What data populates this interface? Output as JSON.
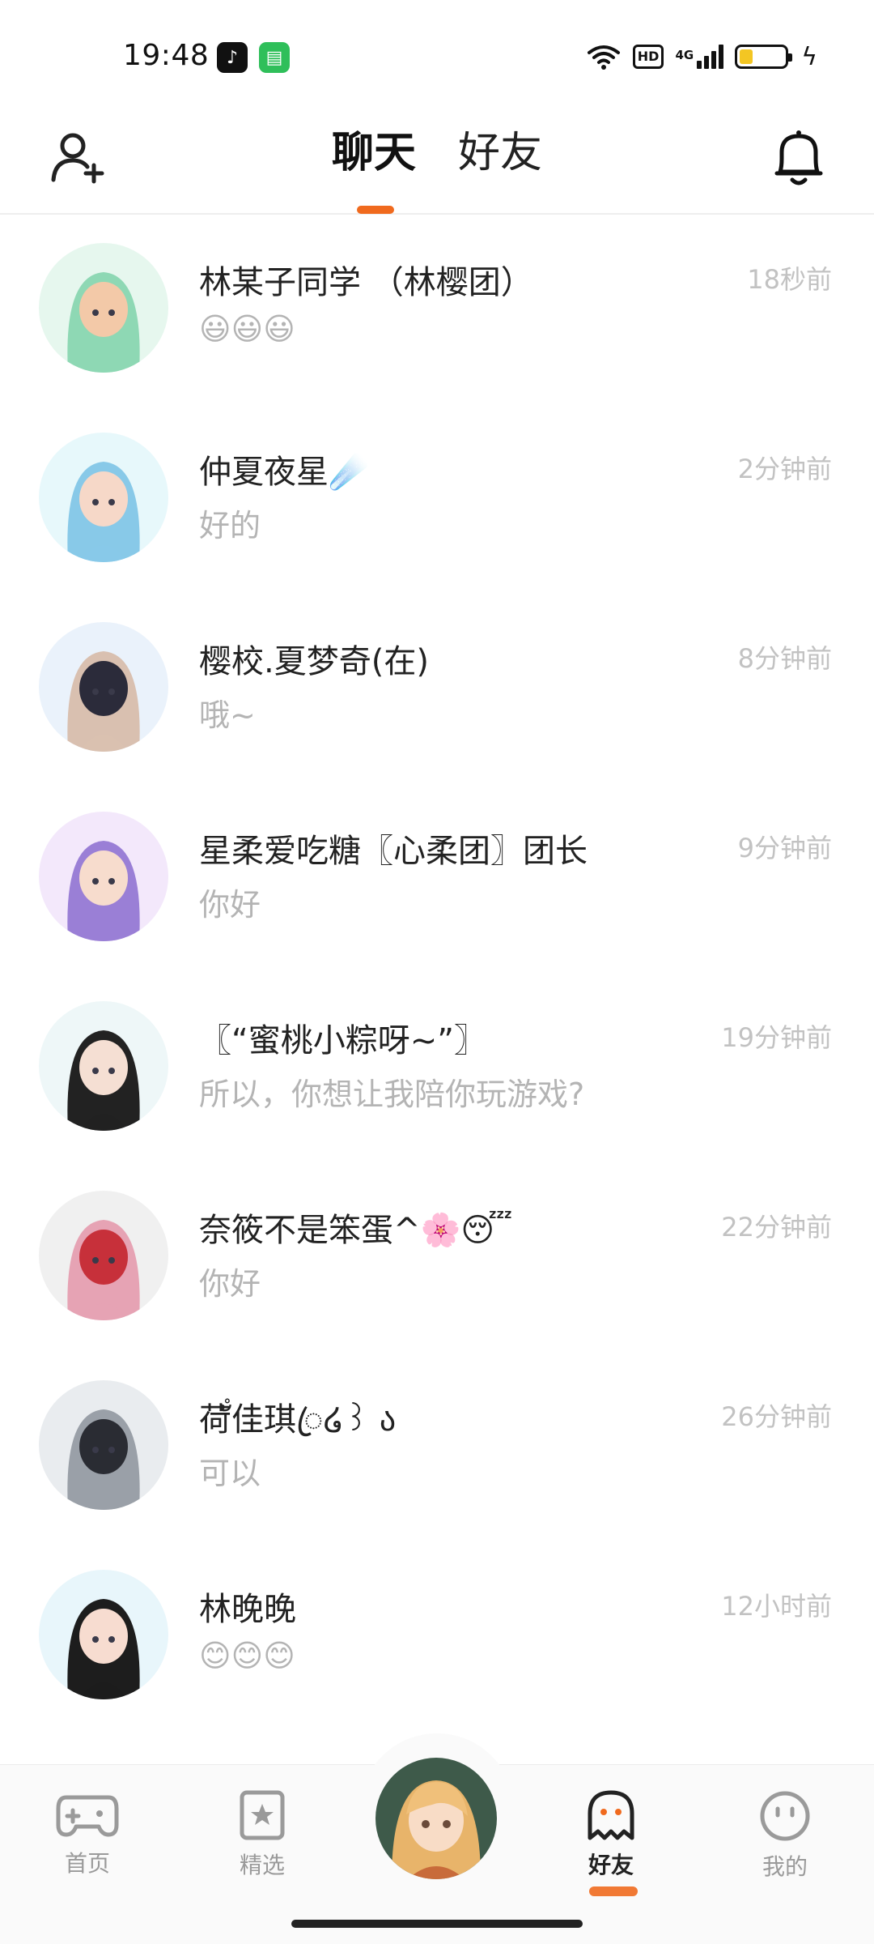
{
  "status_bar": {
    "time": "19:48",
    "hd": "HD",
    "network": "4G",
    "battery_level": 0.3,
    "battery_color": "#f3c623"
  },
  "header": {
    "tabs": [
      {
        "label": "聊天",
        "active": true
      },
      {
        "label": "好友",
        "active": false
      }
    ],
    "accent": "#f06a1e"
  },
  "chats": [
    {
      "name": "林某子同学 （林樱团）",
      "message": "😃😃😃",
      "time": "18秒前",
      "avatar_colors": [
        "#e6f7ee",
        "#8ed8b4",
        "#f3c9a8"
      ]
    },
    {
      "name": "仲夏夜星☄️",
      "message": "好的",
      "time": "2分钟前",
      "avatar_colors": [
        "#e7f8fb",
        "#88c9e8",
        "#f6d8c8"
      ]
    },
    {
      "name": "樱校.夏梦奇(在)",
      "message": "哦~",
      "time": "8分钟前",
      "avatar_colors": [
        "#eaf2fb",
        "#d9c0b0",
        "#2b2b3a"
      ]
    },
    {
      "name": "星柔爱吃糖〖心柔团〗团长",
      "message": "你好",
      "time": "9分钟前",
      "avatar_colors": [
        "#f3e8fb",
        "#9a7fd6",
        "#f7dccd"
      ]
    },
    {
      "name": "〖“蜜桃小粽呀~”〗",
      "message": "所以，你想让我陪你玩游戏?",
      "time": "19分钟前",
      "avatar_colors": [
        "#eef7f8",
        "#222222",
        "#f5dfd3"
      ]
    },
    {
      "name": "奈筱不是笨蛋^🌸😴",
      "message": "你好",
      "time": "22分钟前",
      "avatar_colors": [
        "#f0f0f0",
        "#e6a3b4",
        "#c7303a"
      ]
    },
    {
      "name": "荷ัํ佳琪ꦿ໒꒱ ა",
      "message": "可以",
      "time": "26分钟前",
      "avatar_colors": [
        "#e9ecef",
        "#9aa0a8",
        "#2a2c33"
      ]
    },
    {
      "name": "林晚晚",
      "message": "😊😊😊",
      "time": "12小时前",
      "avatar_colors": [
        "#e8f6fb",
        "#1d1d1d",
        "#f7dcd0"
      ]
    }
  ],
  "bottom_nav": {
    "items": [
      {
        "label": "首页",
        "icon": "gamepad-icon"
      },
      {
        "label": "精选",
        "icon": "star-bookmark-icon"
      },
      {
        "label": "好友",
        "icon": "ghost-icon",
        "active": true
      },
      {
        "label": "我的",
        "icon": "smiley-face-icon"
      }
    ]
  }
}
